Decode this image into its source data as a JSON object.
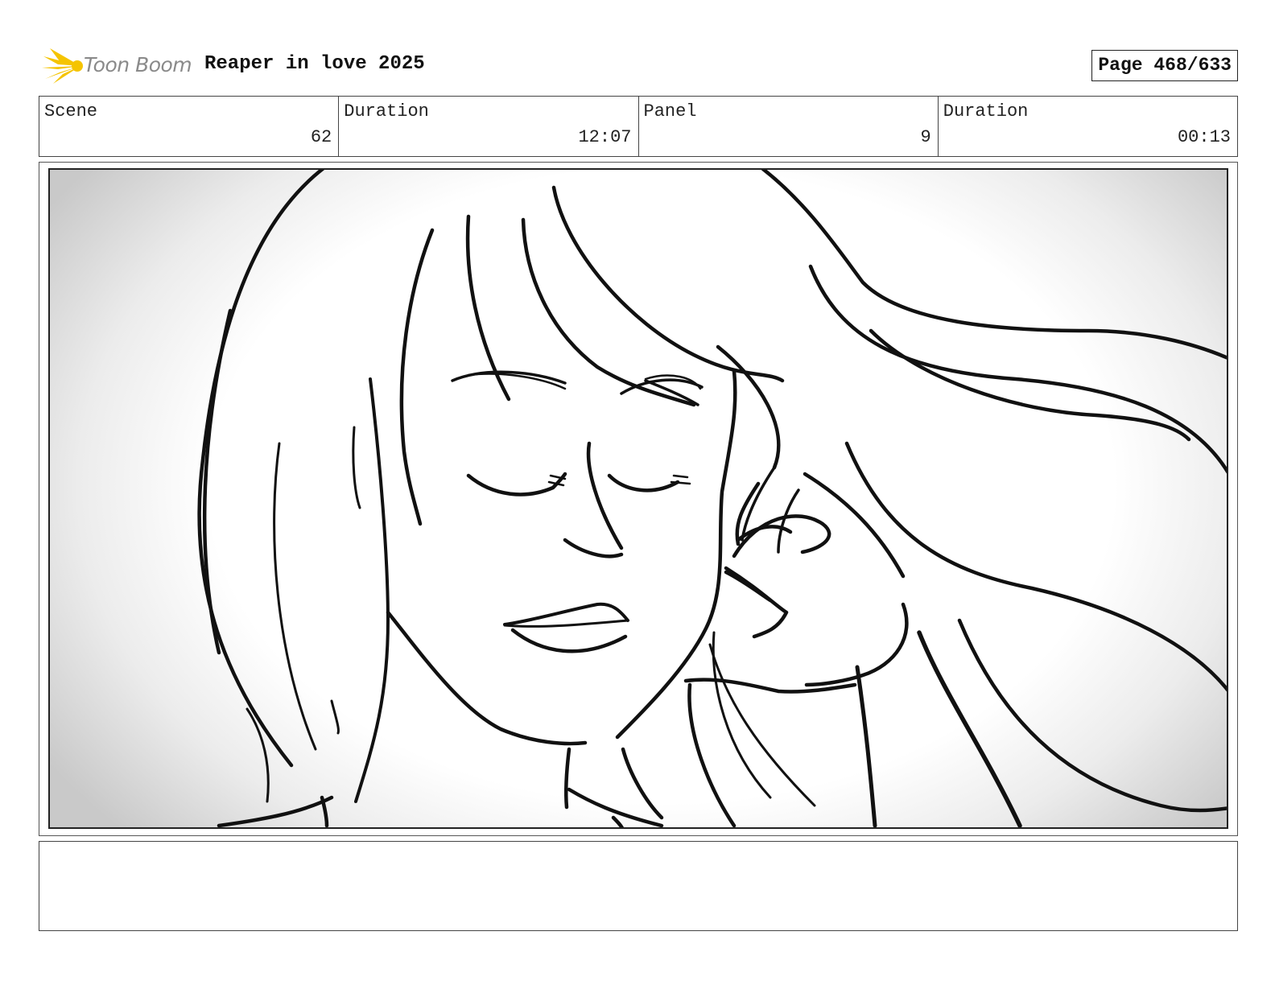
{
  "header": {
    "logo_text": "Toon Boom",
    "project_title": "Reaper in love 2025",
    "page_label": "Page 468/633"
  },
  "info": {
    "scene_label": "Scene",
    "scene_value": "62",
    "scene_duration_label": "Duration",
    "scene_duration_value": "12:07",
    "panel_label": "Panel",
    "panel_value": "9",
    "panel_duration_label": "Duration",
    "panel_duration_value": "00:13"
  },
  "panel": {
    "drawing": "sketch-girl-closed-eyes-windblown-hair"
  },
  "notes": {
    "text": ""
  },
  "colors": {
    "logo_yellow": "#f5c400",
    "logo_text_grey": "#8a8a8a",
    "line": "#111111"
  }
}
